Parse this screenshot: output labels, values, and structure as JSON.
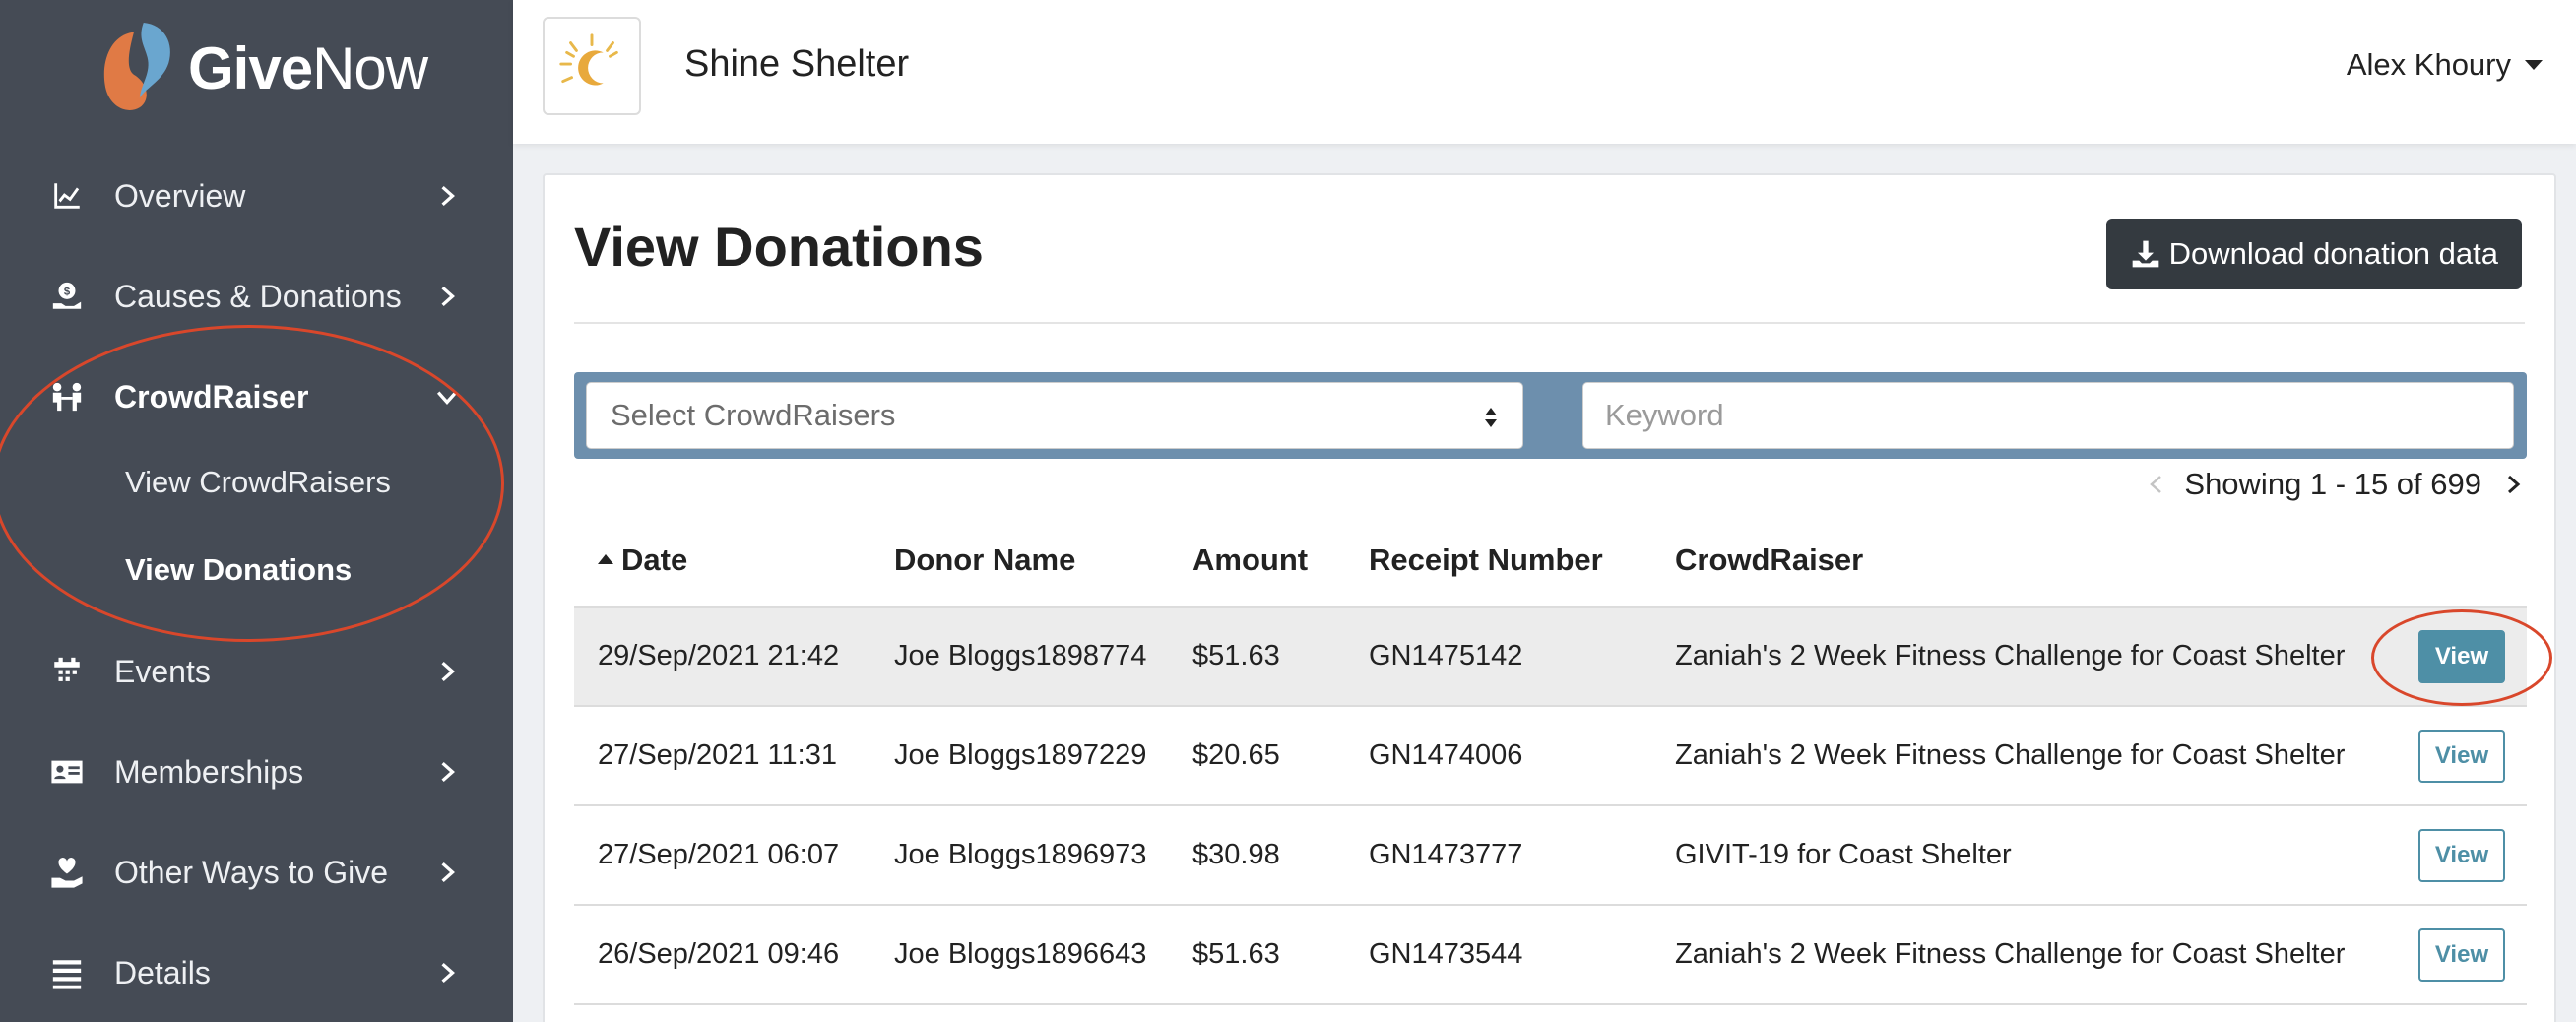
{
  "brand": {
    "name_bold": "Give",
    "name_light": "Now"
  },
  "sidebar": {
    "items": [
      {
        "label": "Overview",
        "icon": "chart-line-icon"
      },
      {
        "label": "Causes & Donations",
        "icon": "hand-coin-icon"
      },
      {
        "label": "CrowdRaiser",
        "icon": "people-icon",
        "expanded": true
      },
      {
        "label": "Events",
        "icon": "calendar-icon"
      },
      {
        "label": "Memberships",
        "icon": "id-card-icon"
      },
      {
        "label": "Other Ways to Give",
        "icon": "hand-holding-heart-icon"
      },
      {
        "label": "Details",
        "icon": "list-icon"
      }
    ],
    "subitems": [
      {
        "label": "View CrowdRaisers"
      },
      {
        "label": "View Donations",
        "active": true
      }
    ]
  },
  "header": {
    "org_name": "Shine Shelter",
    "user_name": "Alex Khoury"
  },
  "main": {
    "title": "View Donations",
    "download_label": "Download donation data",
    "select_placeholder": "Select CrowdRaisers",
    "keyword_placeholder": "Keyword",
    "pagination": "Showing 1 - 15 of 699",
    "columns": [
      "Date",
      "Donor Name",
      "Amount",
      "Receipt Number",
      "CrowdRaiser"
    ],
    "rows": [
      {
        "date": "29/Sep/2021 21:42",
        "donor": "Joe Bloggs1898774",
        "amount": "$51.63",
        "receipt": "GN1475142",
        "crowdraiser": "Zaniah's 2 Week Fitness Challenge for Coast Shelter",
        "action": "View"
      },
      {
        "date": "27/Sep/2021 11:31",
        "donor": "Joe Bloggs1897229",
        "amount": "$20.65",
        "receipt": "GN1474006",
        "crowdraiser": "Zaniah's 2 Week Fitness Challenge for Coast Shelter",
        "action": "View"
      },
      {
        "date": "27/Sep/2021 06:07",
        "donor": "Joe Bloggs1896973",
        "amount": "$30.98",
        "receipt": "GN1473777",
        "crowdraiser": "GIVIT-19 for Coast Shelter",
        "action": "View"
      },
      {
        "date": "26/Sep/2021 09:46",
        "donor": "Joe Bloggs1896643",
        "amount": "$51.63",
        "receipt": "GN1473544",
        "crowdraiser": "Zaniah's 2 Week Fitness Challenge for Coast Shelter",
        "action": "View"
      }
    ]
  },
  "colors": {
    "sidebar_bg": "#454b55",
    "filter_bar": "#6d8fad",
    "accent": "#4e8fa6",
    "annotation": "#d9472b",
    "dark_button": "#343a40"
  }
}
